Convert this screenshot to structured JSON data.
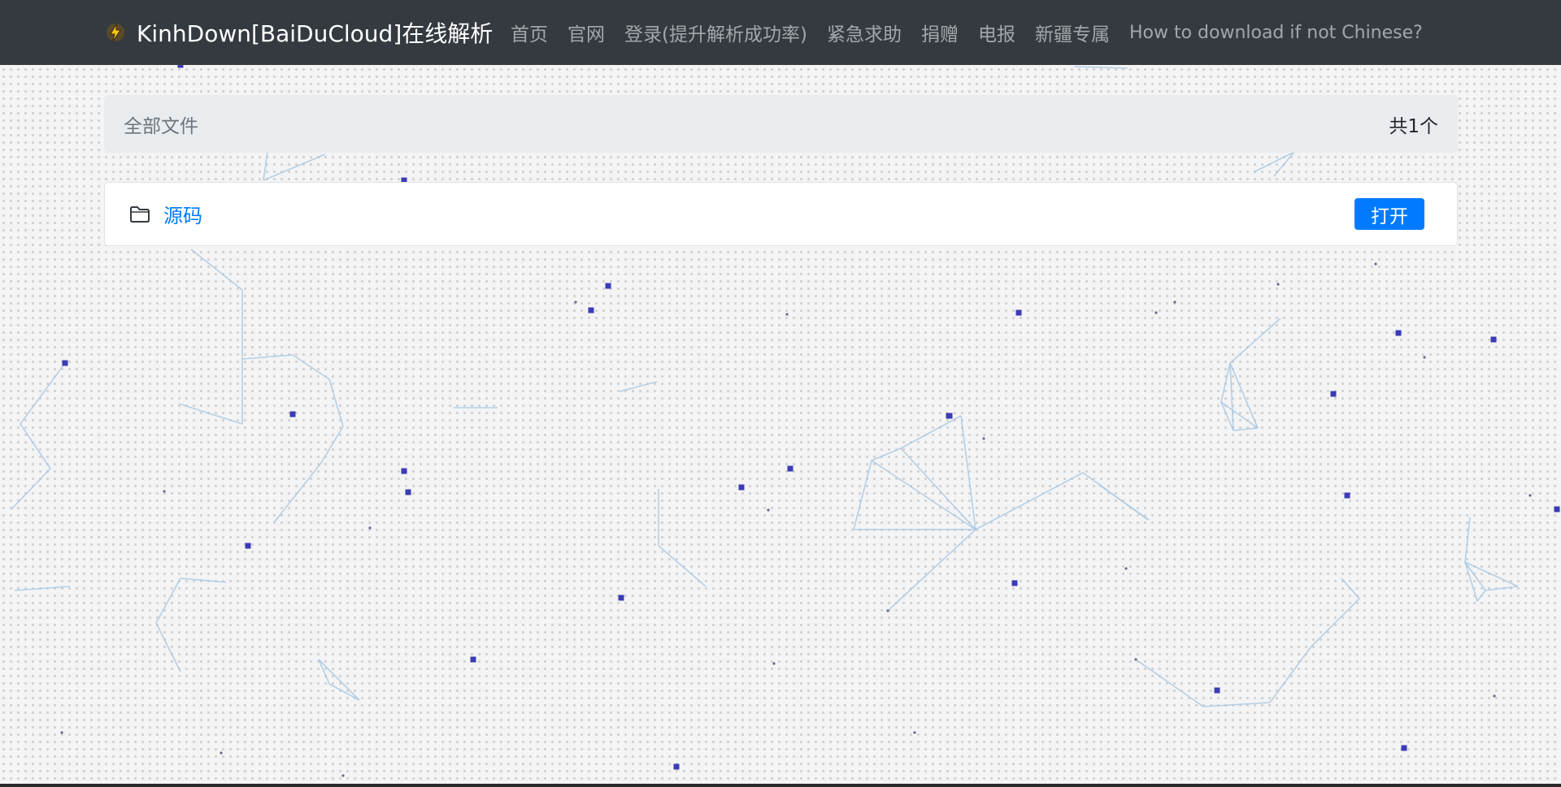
{
  "navbar": {
    "brand_title": "KinhDown[BaiDuCloud]在线解析",
    "brand_icon": "lightning-logo-icon",
    "links": [
      {
        "label": "首页"
      },
      {
        "label": "官网"
      },
      {
        "label": "登录(提升解析成功率)"
      },
      {
        "label": "紧急求助"
      },
      {
        "label": "捐赠"
      },
      {
        "label": "电报"
      },
      {
        "label": "新疆专属"
      },
      {
        "label": "How to download if not Chinese?"
      }
    ]
  },
  "breadcrumb": {
    "path": "全部文件",
    "count": "共1个"
  },
  "files": [
    {
      "name": "源码",
      "icon": "folder-icon",
      "action_label": "打开"
    }
  ],
  "colors": {
    "navbar": "#343a40",
    "link": "#007bff",
    "button": "#007bff",
    "breadcrumb_bg": "#e9ecef",
    "particles": "#3b3bb8"
  }
}
